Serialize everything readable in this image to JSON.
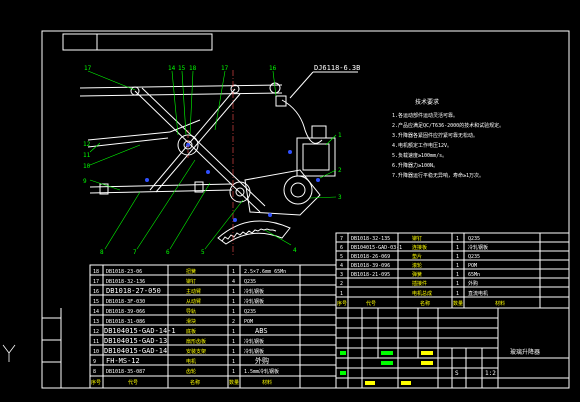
{
  "model_label": "DJ6118-6.3B",
  "title_block_name": "玻璃升降器",
  "scale_s": "S",
  "scale_value": "1:2",
  "balloons": [
    "17",
    "14",
    "15",
    "18",
    "17",
    "16",
    "1",
    "2",
    "3",
    "4",
    "5",
    "6",
    "7",
    "8",
    "9",
    "10",
    "11",
    "12"
  ],
  "tech_req": {
    "title": "技术要求",
    "lines": [
      "1.各运动部件运动灵活可靠。",
      "2.产品应满足QC/T636-2000的技术和试验规定。",
      "3.升降器各紧固件应拧紧可靠无松动。",
      "4.电机额定工作电压12V。",
      "5.负载速度≥100mm/s。",
      "6.升降器力≥100N。",
      "7.升降器运行平稳无异响，寿命≥1万次。"
    ]
  },
  "bom_left": [
    {
      "no": "18",
      "code": "DB1018-23-06",
      "name": "扭簧",
      "qty": "1",
      "material": "2.5×7.6mm  65Mn"
    },
    {
      "no": "17",
      "code": "DB1018-32-136",
      "name": "铆钉",
      "qty": "4",
      "material": "Q235"
    },
    {
      "no": "16",
      "code": "DB1018-27-050",
      "name": "主动臂",
      "qty": "1",
      "material": "冷轧钢板"
    },
    {
      "no": "15",
      "code": "DB1018-3F-030",
      "name": "从动臂",
      "qty": "1",
      "material": "冷轧钢板"
    },
    {
      "no": "14",
      "code": "DB1018-39-066",
      "name": "导轨",
      "qty": "1",
      "material": "Q235"
    },
    {
      "no": "13",
      "code": "DB1018-31-086",
      "name": "滑块",
      "qty": "2",
      "material": "POM"
    },
    {
      "no": "12",
      "code": "DB104015-GAD-14-1",
      "name": "底板",
      "qty": "1",
      "material": "ABS"
    },
    {
      "no": "11",
      "code": "DB104015-GAD-13",
      "name": "扇形齿板",
      "qty": "1",
      "material": "冷轧钢板"
    },
    {
      "no": "10",
      "code": "DB104015-GAD-14",
      "name": "安装支架",
      "qty": "1",
      "material": "冷轧钢板"
    },
    {
      "no": "9",
      "code": "FH-MS-12",
      "name": "电机",
      "qty": "1",
      "material": "外购"
    },
    {
      "no": "8",
      "code": "DB1018-35-087",
      "name": "齿轮",
      "qty": "1",
      "material": "1.5mm冷轧钢板"
    }
  ],
  "bom_right": [
    {
      "no": "7",
      "code": "DB1018-32-135",
      "name": "铆钉",
      "qty": "1",
      "material": "Q235"
    },
    {
      "no": "6",
      "code": "DB104015-GAD-03-1",
      "name": "连接板",
      "qty": "1",
      "material": "冷轧钢板"
    },
    {
      "no": "5",
      "code": "DB1018-26-069",
      "name": "垫片",
      "qty": "1",
      "material": "Q235"
    },
    {
      "no": "4",
      "code": "DB1018-39-096",
      "name": "滚轮",
      "qty": "1",
      "material": "POM"
    },
    {
      "no": "3",
      "code": "DB1018-21-095",
      "name": "弹簧",
      "qty": "1",
      "material": "65Mn"
    },
    {
      "no": "2",
      "code": "",
      "name": "插接件",
      "qty": "1",
      "material": "外购"
    },
    {
      "no": "1",
      "code": "",
      "name": "电机总成",
      "qty": "1",
      "material": "直流电机"
    }
  ],
  "bom_header": {
    "no": "序号",
    "code": "代号",
    "name": "名称",
    "qty": "数量",
    "material": "材料"
  }
}
